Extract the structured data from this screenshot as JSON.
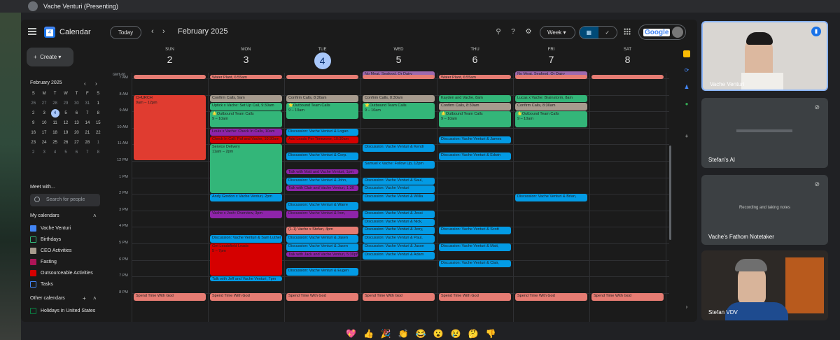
{
  "presenter": "Vache Venturi (Presenting)",
  "app": {
    "title": "Calendar",
    "logo_day": "4"
  },
  "header": {
    "today": "Today",
    "prev": "‹",
    "next": "›",
    "month": "February 2025",
    "view": "Week",
    "google": "Google"
  },
  "sidebar": {
    "create": "Create",
    "mini_month": "February 2025",
    "mini_days": [
      "S",
      "M",
      "T",
      "W",
      "T",
      "F",
      "S"
    ],
    "mini_dates": [
      "26",
      "27",
      "28",
      "29",
      "30",
      "31",
      "1",
      "2",
      "3",
      "4",
      "5",
      "6",
      "7",
      "8",
      "9",
      "10",
      "11",
      "12",
      "13",
      "14",
      "15",
      "16",
      "17",
      "18",
      "19",
      "20",
      "21",
      "22",
      "23",
      "24",
      "25",
      "26",
      "27",
      "28",
      "1",
      "2",
      "3",
      "4",
      "5",
      "6",
      "7",
      "8"
    ],
    "meet_with": "Meet with...",
    "search_people": "Search for people",
    "my_calendars": "My calendars",
    "calendars": [
      {
        "name": "Vache Venturi",
        "color": "#4285f4",
        "checked": true
      },
      {
        "name": "Birthdays",
        "color": "#33b679",
        "checked": false
      },
      {
        "name": "CEO Activities",
        "color": "#a79b8e",
        "checked": true
      },
      {
        "name": "Fasting",
        "color": "#ad1457",
        "checked": true
      },
      {
        "name": "Outsourceable Activities",
        "color": "#d50000",
        "checked": true
      },
      {
        "name": "Tasks",
        "color": "#4285f4",
        "checked": false
      }
    ],
    "other_calendars": "Other calendars",
    "other": [
      {
        "name": "Holidays in United States",
        "color": "#0b8043",
        "checked": false
      }
    ]
  },
  "week": {
    "tz": "GMT-06",
    "days": [
      {
        "name": "SUN",
        "date": "2"
      },
      {
        "name": "MON",
        "date": "3"
      },
      {
        "name": "TUE",
        "date": "4",
        "today": true
      },
      {
        "name": "WED",
        "date": "5"
      },
      {
        "name": "THU",
        "date": "6"
      },
      {
        "name": "FRI",
        "date": "7"
      },
      {
        "name": "SAT",
        "date": "8"
      }
    ],
    "hours": [
      "7 AM",
      "8 AM",
      "9 AM",
      "10 AM",
      "11 AM",
      "12 PM",
      "1 PM",
      "2 PM",
      "3 PM",
      "4 PM",
      "5 PM",
      "6 PM",
      "7 PM",
      "8 PM"
    ]
  },
  "colors": {
    "green": "#33b679",
    "blue": "#039be5",
    "purple": "#8e24aa",
    "red": "#d50000",
    "orange": "#f4511e",
    "tan": "#a79b8e",
    "salmon": "#e67c73",
    "lavender": "#9e69af",
    "pink": "#ad1457"
  },
  "events": [
    {
      "d": 3,
      "s": 6.55,
      "e": 7.0,
      "c": "#9e69af",
      "t": "No Meat, Seafood, Or Dairy"
    },
    {
      "d": 5,
      "s": 6.55,
      "e": 7.0,
      "c": "#9e69af",
      "t": "No Meat, Seafood, Or Dairy"
    },
    {
      "d": 0,
      "s": 6.8,
      "e": 7.05,
      "c": "#e67c73",
      "t": ""
    },
    {
      "d": 1,
      "s": 6.8,
      "e": 7.05,
      "c": "#e67c73",
      "t": "Water Plant, 6:55am"
    },
    {
      "d": 2,
      "s": 6.8,
      "e": 7.05,
      "c": "#e67c73",
      "t": ""
    },
    {
      "d": 3,
      "s": 6.8,
      "e": 7.05,
      "c": "#e67c73",
      "t": ""
    },
    {
      "d": 4,
      "s": 6.8,
      "e": 7.05,
      "c": "#e67c73",
      "t": "Water Plant, 6:55am"
    },
    {
      "d": 5,
      "s": 6.8,
      "e": 7.05,
      "c": "#e67c73",
      "t": ""
    },
    {
      "d": 6,
      "s": 6.8,
      "e": 7.05,
      "c": "#e67c73",
      "t": ""
    },
    {
      "d": 0,
      "s": 8.0,
      "e": 12.0,
      "c": "#e03c30",
      "t": "CHURCH",
      "sub": "9am – 12pm",
      "big": true
    },
    {
      "d": 1,
      "s": 8.0,
      "e": 8.5,
      "c": "#a79b8e",
      "t": "Confirm Calls, 9am"
    },
    {
      "d": 1,
      "s": 8.5,
      "e": 9.0,
      "c": "#33b679",
      "t": "Uptick x Vache: Set Up Call, 9:30am"
    },
    {
      "d": 1,
      "s": 9.0,
      "e": 10.0,
      "c": "#33b679",
      "t": "🌟Outbound Team Calls",
      "sub": "9 – 10am",
      "big": true
    },
    {
      "d": 1,
      "s": 10.05,
      "e": 10.5,
      "c": "#8e24aa",
      "t": "Louis x Vache: Check In Calls, 10am"
    },
    {
      "d": 1,
      "s": 10.5,
      "e": 11.0,
      "c": "#d50000",
      "t": "Check In Call: Paf and Vache, 10:30am"
    },
    {
      "d": 1,
      "s": 11.0,
      "e": 14.0,
      "c": "#33b679",
      "t": "Service Delivery",
      "sub": "11am – 2pm",
      "big": true
    },
    {
      "d": 1,
      "s": 14.0,
      "e": 14.5,
      "c": "#039be5",
      "t": "Andy Gordon x Vache Venturi, 2pm"
    },
    {
      "d": 1,
      "s": 15.0,
      "e": 15.5,
      "c": "#8e24aa",
      "t": "Vache x Josh: Overview, 3pm"
    },
    {
      "d": 1,
      "s": 16.5,
      "e": 17.0,
      "c": "#039be5",
      "t": "Discussion: Vache Venturi & Sam Luther"
    },
    {
      "d": 1,
      "s": 17.0,
      "e": 19.0,
      "c": "#d50000",
      "t": "Get Leadsfield Leads",
      "sub": "5 – 7pm",
      "big": true
    },
    {
      "d": 1,
      "s": 19.0,
      "e": 19.35,
      "c": "#039be5",
      "t": "Talk with Jeff and Vache Venturi, 7pm"
    },
    {
      "d": 2,
      "s": 8.0,
      "e": 8.5,
      "c": "#a79b8e",
      "t": "Confirm Calls, 8:30am"
    },
    {
      "d": 2,
      "s": 8.5,
      "e": 9.5,
      "c": "#33b679",
      "t": "🌟Outbound Team Calls",
      "sub": "9 – 10am",
      "big": true
    },
    {
      "d": 2,
      "s": 10.05,
      "e": 10.5,
      "c": "#039be5",
      "t": "Discussion: Vache Venturi & Logan"
    },
    {
      "d": 2,
      "s": 10.5,
      "e": 11.0,
      "c": "#d50000",
      "t": "Add Leads Per Timezone, 10:30am"
    },
    {
      "d": 2,
      "s": 11.5,
      "e": 12.0,
      "c": "#039be5",
      "t": "Discussion: Vache Venturi & Corp."
    },
    {
      "d": 2,
      "s": 12.5,
      "e": 12.85,
      "c": "#8e24aa",
      "t": "Talk with Matt and Vache Venturi, 1pm"
    },
    {
      "d": 2,
      "s": 13.0,
      "e": 13.5,
      "c": "#039be5",
      "t": "Discussion: Vache Venturi & John,"
    },
    {
      "d": 2,
      "s": 13.5,
      "e": 13.85,
      "c": "#8e24aa",
      "t": "Talk with Clair and Vache Venturi, 1:30"
    },
    {
      "d": 2,
      "s": 14.5,
      "e": 15.0,
      "c": "#039be5",
      "t": "Discussion: Vache Venturi & Warre"
    },
    {
      "d": 2,
      "s": 15.0,
      "e": 15.5,
      "c": "#8e24aa",
      "t": "Discussion: Vache Venturi & Iron,"
    },
    {
      "d": 2,
      "s": 16.0,
      "e": 16.5,
      "c": "#e67c73",
      "t": "(1-1) Vache x Stefan, 4pm"
    },
    {
      "d": 2,
      "s": 16.5,
      "e": 17.0,
      "c": "#039be5",
      "t": "Discussion: Vache Venturi & Jasen"
    },
    {
      "d": 2,
      "s": 17.0,
      "e": 17.5,
      "c": "#039be5",
      "t": "Discussion: Vache Venturi & Jasen"
    },
    {
      "d": 2,
      "s": 17.5,
      "e": 17.85,
      "c": "#8e24aa",
      "t": "Talk with Jack and Vache Venturi, 5:30pm"
    },
    {
      "d": 2,
      "s": 18.5,
      "e": 19.0,
      "c": "#039be5",
      "t": "Discussion: Vache Venturi & Eugen"
    },
    {
      "d": 3,
      "s": 8.0,
      "e": 8.5,
      "c": "#a79b8e",
      "t": "Confirm Calls, 8:30am"
    },
    {
      "d": 3,
      "s": 8.5,
      "e": 9.5,
      "c": "#33b679",
      "t": "🌟Outbound Team Calls",
      "sub": "9 – 10am",
      "big": true
    },
    {
      "d": 3,
      "s": 11.0,
      "e": 11.5,
      "c": "#039be5",
      "t": "Discussion: Vache Venturi & Kendr"
    },
    {
      "d": 3,
      "s": 12.0,
      "e": 12.5,
      "c": "#039be5",
      "t": "Samuel x Vache: Follow Up, 12pm"
    },
    {
      "d": 3,
      "s": 13.0,
      "e": 13.5,
      "c": "#039be5",
      "t": "Discussion: Vache Venturi & Saul,"
    },
    {
      "d": 3,
      "s": 13.5,
      "e": 14.0,
      "c": "#039be5",
      "t": "Discussion: Vache Venturi"
    },
    {
      "d": 3,
      "s": 14.0,
      "e": 14.5,
      "c": "#039be5",
      "t": "Discussion: Vache Venturi & Willia"
    },
    {
      "d": 3,
      "s": 15.0,
      "e": 15.5,
      "c": "#039be5",
      "t": "Discussion: Vache Venturi & Jessi"
    },
    {
      "d": 3,
      "s": 15.5,
      "e": 16.0,
      "c": "#039be5",
      "t": "Discussion: Vache Venturi & Nick,"
    },
    {
      "d": 3,
      "s": 16.0,
      "e": 16.5,
      "c": "#039be5",
      "t": "Discussion: Vache Venturi & Jerry,"
    },
    {
      "d": 3,
      "s": 16.5,
      "e": 17.0,
      "c": "#039be5",
      "t": "Discussion: Vache Venturi & Paul,"
    },
    {
      "d": 3,
      "s": 17.0,
      "e": 17.5,
      "c": "#039be5",
      "t": "Discussion: Vache Venturi & Jason"
    },
    {
      "d": 3,
      "s": 17.5,
      "e": 18.0,
      "c": "#039be5",
      "t": "Discussion: Vache Venturi & Adam"
    },
    {
      "d": 4,
      "s": 8.0,
      "e": 8.5,
      "c": "#33b679",
      "t": "Kayden and Vache, 8am"
    },
    {
      "d": 4,
      "s": 8.5,
      "e": 9.0,
      "c": "#a79b8e",
      "t": "Confirm Calls, 8:30am"
    },
    {
      "d": 4,
      "s": 9.0,
      "e": 10.0,
      "c": "#33b679",
      "t": "🌟Outbound Team Calls",
      "sub": "9 – 10am",
      "big": true
    },
    {
      "d": 4,
      "s": 10.5,
      "e": 11.0,
      "c": "#039be5",
      "t": "Discussion: Vache Venturi & James"
    },
    {
      "d": 4,
      "s": 11.5,
      "e": 12.0,
      "c": "#039be5",
      "t": "Discussion: Vache Venturi & Edwin"
    },
    {
      "d": 4,
      "s": 16.0,
      "e": 16.5,
      "c": "#039be5",
      "t": "Discussion: Vache Venturi & Scott"
    },
    {
      "d": 4,
      "s": 17.0,
      "e": 17.5,
      "c": "#039be5",
      "t": "Discussion: Vache Venturi & Matt,"
    },
    {
      "d": 4,
      "s": 18.0,
      "e": 18.5,
      "c": "#039be5",
      "t": "Discussion: Vache Venturi & Clair,"
    },
    {
      "d": 5,
      "s": 8.0,
      "e": 8.5,
      "c": "#33b679",
      "t": "Lucas x Vache: Brainstorm, 8am"
    },
    {
      "d": 5,
      "s": 8.5,
      "e": 9.0,
      "c": "#a79b8e",
      "t": "Confirm Calls, 8:30am"
    },
    {
      "d": 5,
      "s": 9.0,
      "e": 10.0,
      "c": "#33b679",
      "t": "🌟Outbound Team Calls",
      "sub": "9 – 10am",
      "big": true
    },
    {
      "d": 5,
      "s": 14.0,
      "e": 14.5,
      "c": "#039be5",
      "t": "Discussion: Vache Venturi & Brian,"
    },
    {
      "d": 0,
      "s": 20.0,
      "e": 20.5,
      "c": "#e67c73",
      "t": "Spend Time With God"
    },
    {
      "d": 1,
      "s": 20.0,
      "e": 20.5,
      "c": "#e67c73",
      "t": "Spend Time With God"
    },
    {
      "d": 2,
      "s": 20.0,
      "e": 20.5,
      "c": "#e67c73",
      "t": "Spend Time With God"
    },
    {
      "d": 3,
      "s": 20.0,
      "e": 20.5,
      "c": "#e67c73",
      "t": "Spend Time With God"
    },
    {
      "d": 4,
      "s": 20.0,
      "e": 20.5,
      "c": "#e67c73",
      "t": "Spend Time With God"
    },
    {
      "d": 5,
      "s": 20.0,
      "e": 20.5,
      "c": "#e67c73",
      "t": "Spend Time With God"
    },
    {
      "d": 6,
      "s": 20.0,
      "e": 20.5,
      "c": "#e67c73",
      "t": "Spend Time With God"
    }
  ],
  "participants": [
    {
      "name": "Vache Venturi"
    },
    {
      "name": "Stefan's AI"
    },
    {
      "name": "Vache's Fathom Notetaker",
      "status": "Recording and taking notes"
    },
    {
      "name": "Stefan VDV"
    }
  ],
  "reactions": [
    "💖",
    "👍",
    "🎉",
    "👏",
    "😂",
    "😮",
    "😢",
    "🤔",
    "👎"
  ]
}
